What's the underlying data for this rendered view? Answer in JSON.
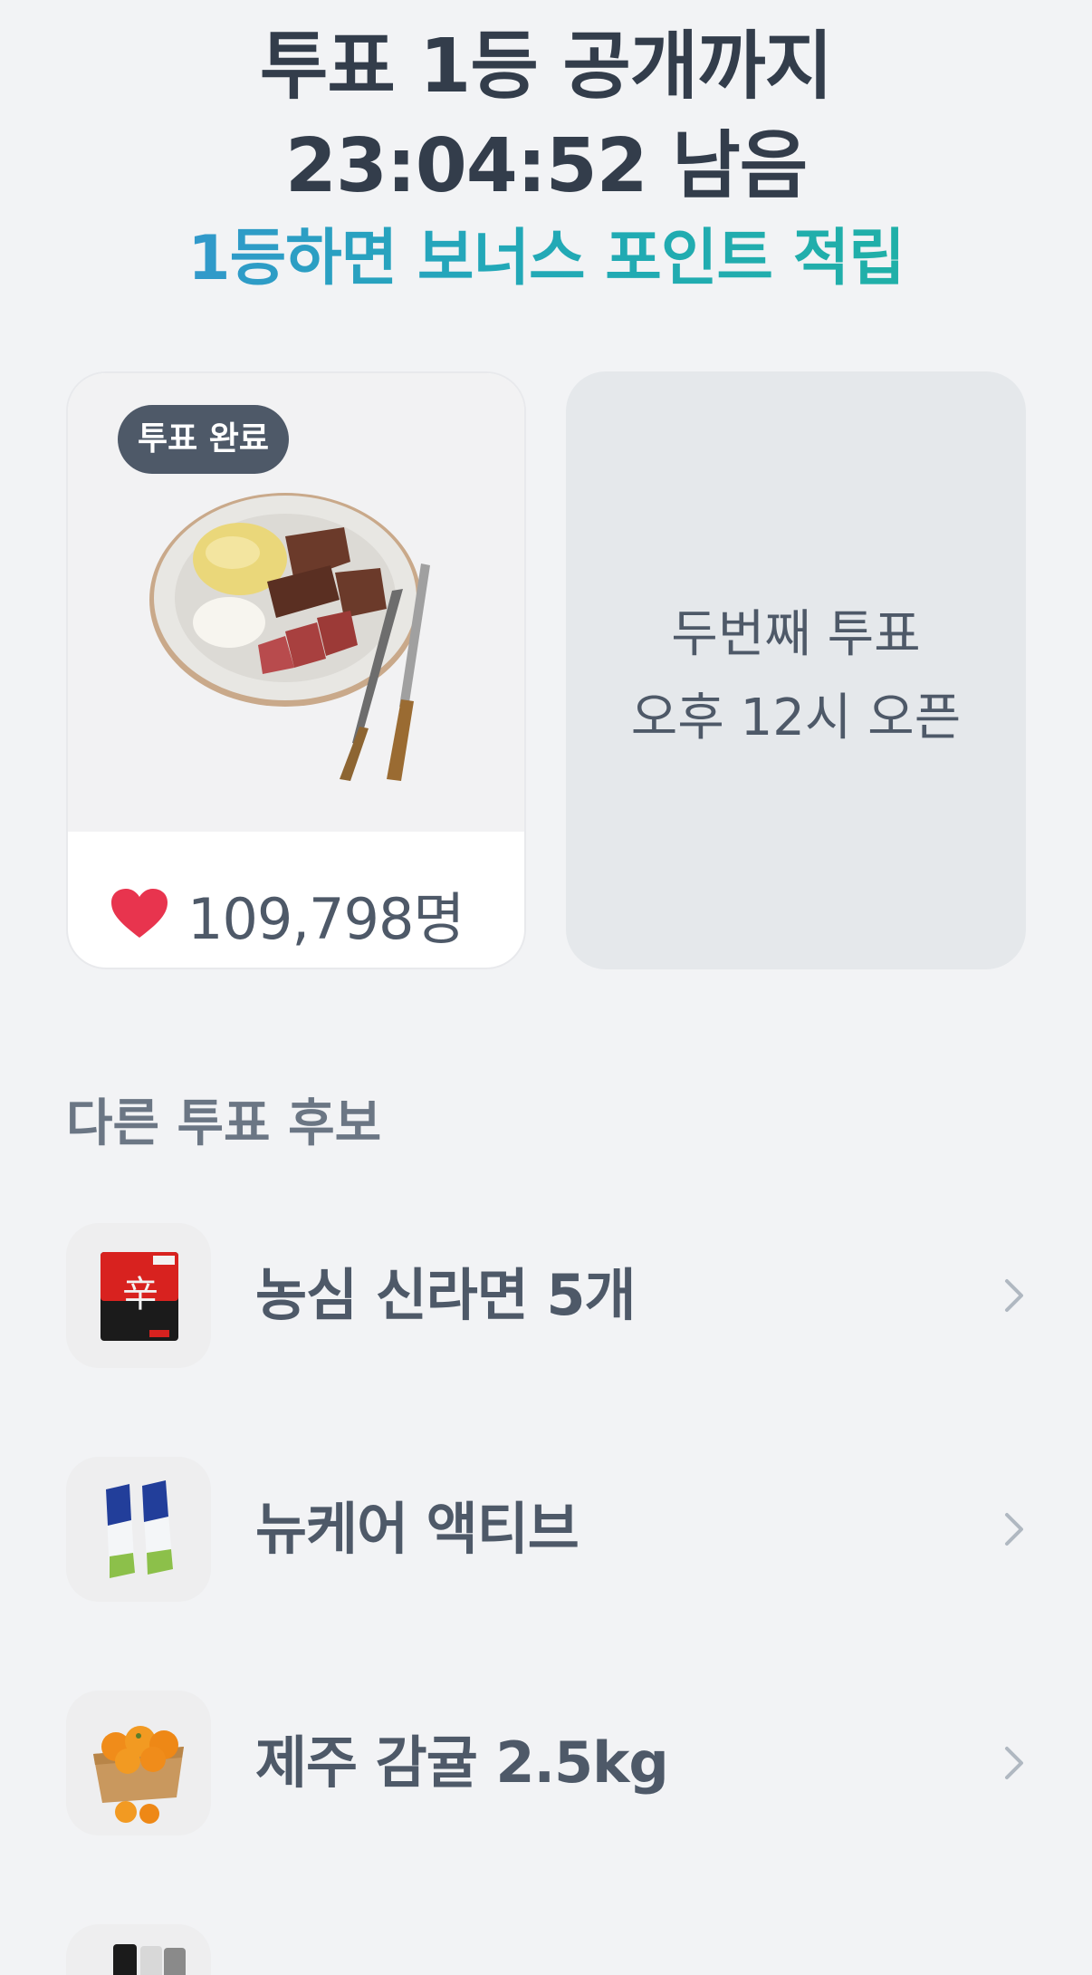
{
  "header": {
    "line1": "투표 1등 공개까지",
    "line2": "23:04:52 남음",
    "bonus": "1등하면 보너스 포인트 적립"
  },
  "vote_card": {
    "badge": "투표 완료",
    "count": "109,798명",
    "image": "steak-plate",
    "heart_color": "#e8344e"
  },
  "next_card": {
    "line1": "두번째 투표",
    "line2": "오후 12시 오픈"
  },
  "section": {
    "title": "다른 투표 후보"
  },
  "candidates": [
    {
      "label": "농심 신라면 5개",
      "image": "ramen-pack-icon"
    },
    {
      "label": "뉴케어 액티브",
      "image": "milk-carton-icon"
    },
    {
      "label": "제주 감귤 2.5kg",
      "image": "tangerine-basket-icon"
    },
    {
      "label": "",
      "image": "socks-icon"
    }
  ],
  "colors": {
    "background": "#f2f3f5",
    "title_text": "#333d4b",
    "body_text": "#4e5968",
    "muted_text": "#6b7684",
    "bonus_gradient_start": "#3b8fd6",
    "bonus_gradient_end": "#1fb3a0"
  }
}
